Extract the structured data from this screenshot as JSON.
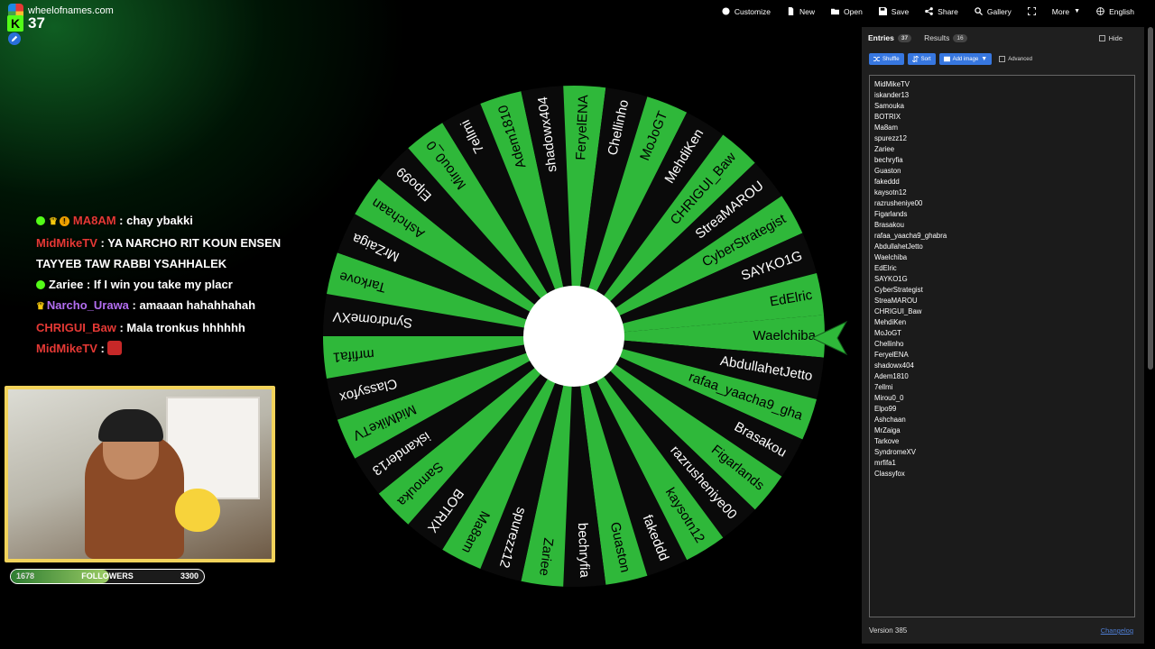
{
  "site": {
    "name": "wheelofnames.com"
  },
  "nav": {
    "customize": "Customize",
    "new": "New",
    "open": "Open",
    "save": "Save",
    "share": "Share",
    "gallery": "Gallery",
    "more": "More",
    "language": "English"
  },
  "stream": {
    "viewer_count": "37",
    "kick_badge": "K",
    "chat": [
      {
        "user": "MA8AM",
        "sep": " : ",
        "text": "chay ybakki",
        "color": "#e53935"
      },
      {
        "user": "MidMikeTV",
        "sep": " : ",
        "text": "YA NARCHO RIT KOUN ENSEN TAYYEB TAW RABBI YSAHHALEK",
        "color": "#e53935"
      },
      {
        "user": "Zariee",
        "sep": " : ",
        "text": "If I win you take my placr",
        "color": "#ffffff"
      },
      {
        "user": "Narcho_Urawa",
        "sep": " : ",
        "text": "amaaan hahahhahah",
        "color": "#b36ef0"
      },
      {
        "user": "CHRIGUI_Baw",
        "sep": " : ",
        "text": "Mala tronkus hhhhhh",
        "color": "#e53935"
      },
      {
        "user": "MidMikeTV",
        "sep": " : ",
        "text": "",
        "color": "#e53935"
      }
    ],
    "followers": {
      "current": "1678",
      "label": "FOLLOWERS",
      "goal": "3300",
      "progress": 0.51
    }
  },
  "wheel": {
    "colors": {
      "green": "#2fb83a",
      "black": "#0a0a0a",
      "pointer": "#2fb83a"
    },
    "labels": [
      "Waelchiba",
      "AbdullahetJetto",
      "rafaa_yaacha9_gha",
      "Brasakou",
      "Figarlands",
      "razrusheniye00",
      "kaysotn12",
      "fakeddd",
      "Guaston",
      "bechryfia",
      "Zariee",
      "spurezz12",
      "Ma8am",
      "BOTRIX",
      "Samouka",
      "iskander13",
      "MidMikeTV",
      "Classyfox",
      "mrfifa1",
      "SyndromeXV",
      "Tarkove",
      "MrZaiga",
      "Ashchaan",
      "Elpo99",
      "Mirou0_0",
      "7ellmi",
      "Adem1810",
      "shadowx404",
      "FeryelENA",
      "Chellinho",
      "MoJoGT",
      "MehdiKen",
      "CHRIGUI_Baw",
      "StreaMAROU",
      "CyberStrategist",
      "SAYKO1G",
      "EdElric"
    ]
  },
  "panel": {
    "tab_entries": "Entries",
    "entries_count": "37",
    "tab_results": "Results",
    "results_count": "16",
    "hide_label": "Hide",
    "shuffle": "Shuffle",
    "sort": "Sort",
    "add_image": "Add image",
    "advanced": "Advanced",
    "version": "Version 385",
    "changelog": "Changelog",
    "entries": [
      "MidMikeTV",
      "iskander13",
      "Samouka",
      "BOTRIX",
      "Ma8am",
      "spurezz12",
      "Zariee",
      "bechryfia",
      "Guaston",
      "fakeddd",
      "kaysotn12",
      "razrusheniye00",
      "Figarlands",
      "Brasakou",
      "rafaa_yaacha9_ghabra",
      "AbdullahetJetto",
      "Waelchiba",
      "EdElric",
      "SAYKO1G",
      "CyberStrategist",
      "StreaMAROU",
      "CHRIGUI_Baw",
      "MehdiKen",
      "MoJoGT",
      "Chellinho",
      "FeryelENA",
      "shadowx404",
      "Adem1810",
      "7ellmi",
      "Mirou0_0",
      "Elpo99",
      "Ashchaan",
      "MrZaiga",
      "Tarkove",
      "SyndromeXV",
      "mrfifa1",
      "Classyfox"
    ]
  }
}
